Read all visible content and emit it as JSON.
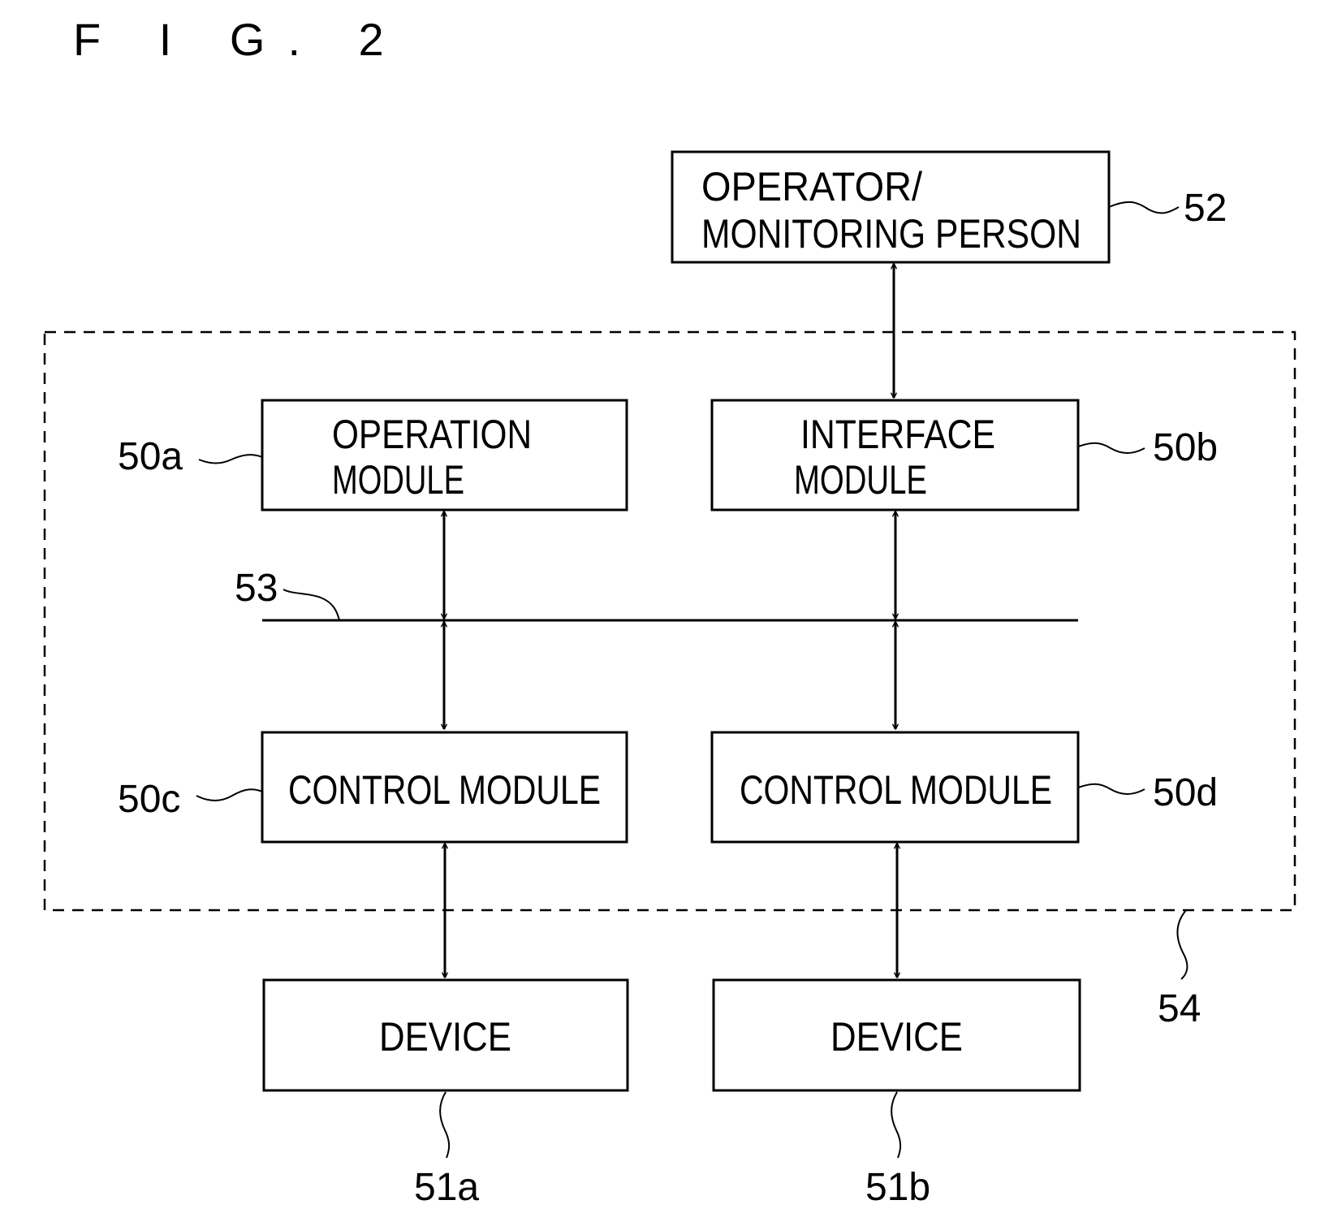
{
  "figure": {
    "title": "F I G. 2"
  },
  "boxes": {
    "operator": {
      "lines": [
        "OPERATOR/",
        "MONITORING PERSON"
      ],
      "ref": "52"
    },
    "operation_module": {
      "lines": [
        "OPERATION",
        "MODULE"
      ],
      "ref": "50a"
    },
    "interface_module": {
      "lines": [
        "INTERFACE",
        "MODULE"
      ],
      "ref": "50b"
    },
    "control_module_left": {
      "lines": [
        "CONTROL MODULE"
      ],
      "ref": "50c"
    },
    "control_module_right": {
      "lines": [
        "CONTROL MODULE"
      ],
      "ref": "50d"
    },
    "device_left": {
      "lines": [
        "DEVICE"
      ],
      "ref": "51a"
    },
    "device_right": {
      "lines": [
        "DEVICE"
      ],
      "ref": "51b"
    }
  },
  "bus": {
    "ref": "53"
  },
  "enclosure": {
    "ref": "54"
  }
}
